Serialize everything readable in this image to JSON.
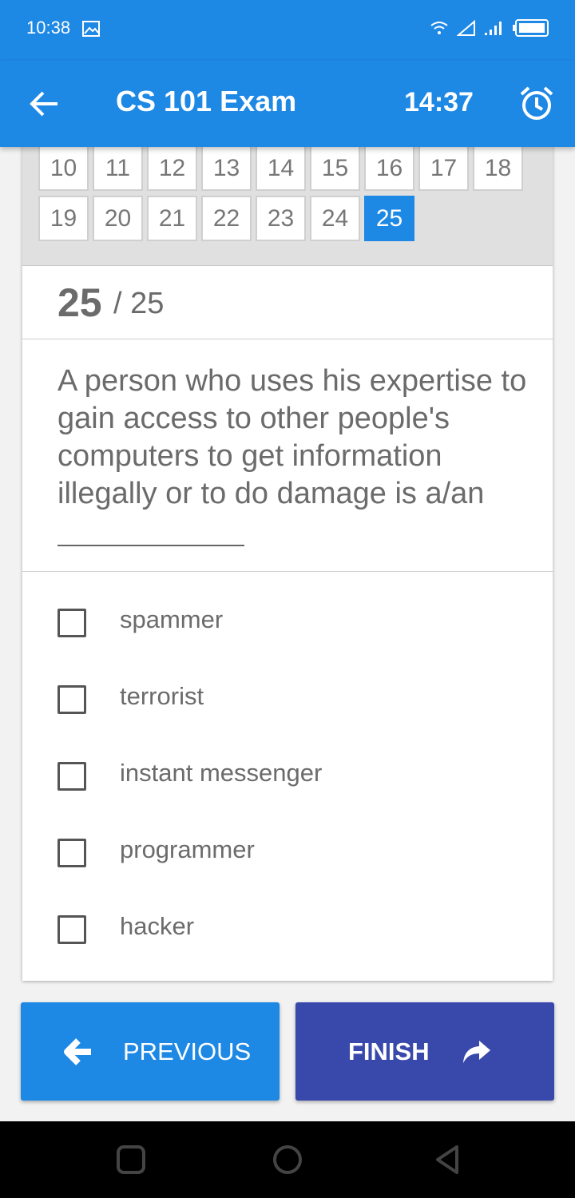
{
  "status_bar": {
    "time": "10:38",
    "icons": [
      "gallery-icon",
      "wifi-icon",
      "signal-icon",
      "signal-bars-icon",
      "battery-icon"
    ]
  },
  "app_bar": {
    "title": "CS 101 Exam",
    "timer": "14:37",
    "back_icon": "arrow-left-icon",
    "alarm_icon": "alarm-clock-icon"
  },
  "question_nav": {
    "rows": [
      [
        "10",
        "11",
        "12",
        "13",
        "14",
        "15",
        "16",
        "17",
        "18"
      ],
      [
        "19",
        "20",
        "21",
        "22",
        "23",
        "24",
        "25"
      ]
    ],
    "active": "25"
  },
  "counter": {
    "current": "25",
    "total": "/ 25"
  },
  "question": {
    "text": "A person who uses his expertise to gain access to other people's computers to get information illegally or to do damage is a/an"
  },
  "options": [
    {
      "label": "spammer",
      "checked": false
    },
    {
      "label": "terrorist",
      "checked": false
    },
    {
      "label": "instant messenger",
      "checked": false
    },
    {
      "label": "programmer",
      "checked": false
    },
    {
      "label": "hacker",
      "checked": false
    }
  ],
  "buttons": {
    "previous": "PREVIOUS",
    "finish": "FINISH"
  },
  "colors": {
    "primary": "#1e88e5",
    "finish": "#3949ab",
    "text": "#6b6b6b"
  }
}
